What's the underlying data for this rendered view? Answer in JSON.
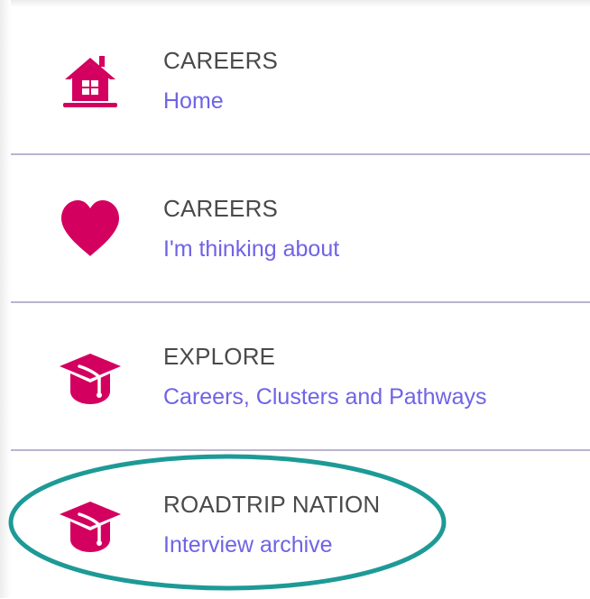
{
  "menu": {
    "items": [
      {
        "title": "CAREERS",
        "subtitle": "Home",
        "icon": "house-icon"
      },
      {
        "title": "CAREERS",
        "subtitle": "I'm thinking about",
        "icon": "heart-icon"
      },
      {
        "title": "EXPLORE",
        "subtitle": "Careers, Clusters and Pathways",
        "icon": "graduation-cap-icon"
      },
      {
        "title": "ROADTRIP NATION",
        "subtitle": "Interview archive",
        "icon": "graduation-cap-icon"
      }
    ]
  },
  "colors": {
    "icon": "#d3005f",
    "title": "#4a4a4a",
    "link": "#6f63e6",
    "divider": "#b9b4cf",
    "highlight": "#1d9a96"
  }
}
